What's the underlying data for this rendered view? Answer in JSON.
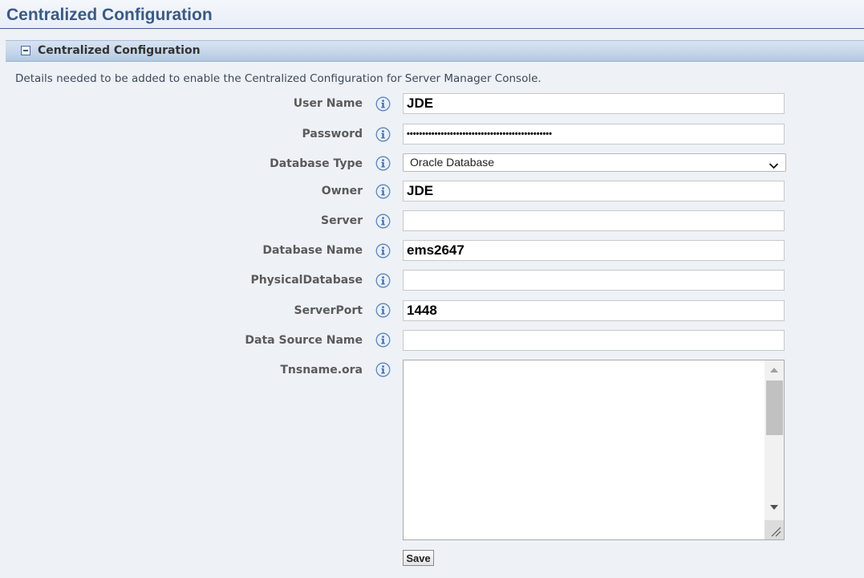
{
  "page": {
    "title": "Centralized Configuration"
  },
  "section": {
    "title": "Centralized Configuration",
    "description": "Details needed to be added to enable the Centralized Configuration for Server Manager Console."
  },
  "fields": {
    "user_name": {
      "label": "User Name",
      "value": "JDE"
    },
    "password": {
      "label": "Password",
      "value": "•••••••••••••••••••••••••••••••••••••••••••••••"
    },
    "database_type": {
      "label": "Database Type",
      "value": "Oracle Database"
    },
    "owner": {
      "label": "Owner",
      "value": "JDE"
    },
    "server": {
      "label": "Server",
      "value": ""
    },
    "database_name": {
      "label": "Database Name",
      "value": "ems2647"
    },
    "physical_database": {
      "label": "PhysicalDatabase",
      "value": ""
    },
    "server_port": {
      "label": "ServerPort",
      "value": "1448"
    },
    "data_source_name": {
      "label": "Data Source Name",
      "value": ""
    },
    "tnsname_ora": {
      "label": "Tnsname.ora",
      "value": ""
    }
  },
  "buttons": {
    "save_label": "Save"
  },
  "icons": {
    "info": "info-icon",
    "collapse": "collapse-minus-icon",
    "dropdown": "chevron-down-icon"
  },
  "colors": {
    "title": "#3a5a84",
    "section_bar": "#c4d5ea",
    "background": "#eef1f5",
    "info_icon": "#5b86c0"
  }
}
